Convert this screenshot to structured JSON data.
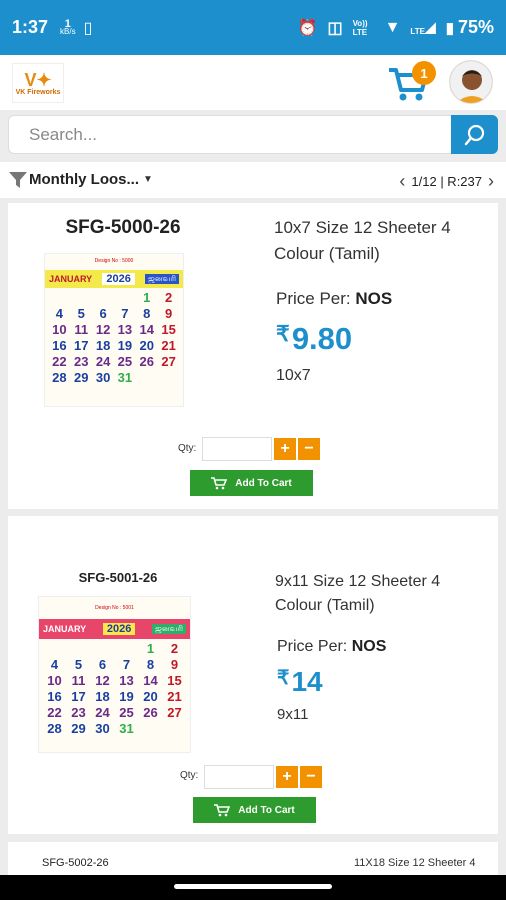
{
  "status": {
    "time": "1:37",
    "speed_num": "1",
    "speed_unit": "kB/s",
    "volte": "Vo)) LTE",
    "lte": "LTE",
    "battery": "75%"
  },
  "header": {
    "logo_text": "VK Fireworks",
    "cart_count": "1"
  },
  "search": {
    "placeholder": "Search..."
  },
  "filter": {
    "label": "Monthly Loos...",
    "pager": "1/12 | R:237"
  },
  "products": [
    {
      "code": "SFG-5000-26",
      "title_line1": "10x7 Size 12 Sheeter 4",
      "title_line2": "Colour (Tamil)",
      "price_per_label": "Price Per:",
      "price_per_unit": "NOS",
      "currency": "₹",
      "price": "9.80",
      "size": "10x7",
      "qty_label": "Qty:",
      "add_to_cart": "Add To Cart",
      "calendar_month": "JANUARY",
      "calendar_year": "2026",
      "calendar_design": "Design No : 5000",
      "calendar_days": [
        "",
        "",
        "",
        "",
        "1",
        "2",
        "4",
        "5",
        "6",
        "7",
        "8",
        "9",
        "10",
        "11",
        "12",
        "13",
        "14",
        "15",
        "16",
        "17",
        "18",
        "19",
        "20",
        "21",
        "22",
        "23",
        "24",
        "25",
        "26",
        "27",
        "28",
        "29",
        "30",
        "31"
      ]
    },
    {
      "code": "SFG-5001-26",
      "title_line1": "9x11 Size 12 Sheeter 4",
      "title_line2": "Colour (Tamil)",
      "price_per_label": "Price Per:",
      "price_per_unit": "NOS",
      "currency": "₹",
      "price": "14",
      "size": "9x11",
      "qty_label": "Qty:",
      "add_to_cart": "Add To Cart",
      "calendar_month": "JANUARY",
      "calendar_year": "2026",
      "calendar_design": "Design No : 5001",
      "calendar_days": [
        "",
        "",
        "",
        "",
        "1",
        "2",
        "4",
        "5",
        "6",
        "7",
        "8",
        "9",
        "10",
        "11",
        "12",
        "13",
        "14",
        "15",
        "16",
        "17",
        "18",
        "19",
        "20",
        "21",
        "22",
        "23",
        "24",
        "25",
        "26",
        "27",
        "28",
        "29",
        "30",
        "31"
      ]
    },
    {
      "code": "SFG-5002-26",
      "title_line1": "11X18 Size 12 Sheeter 4"
    }
  ]
}
